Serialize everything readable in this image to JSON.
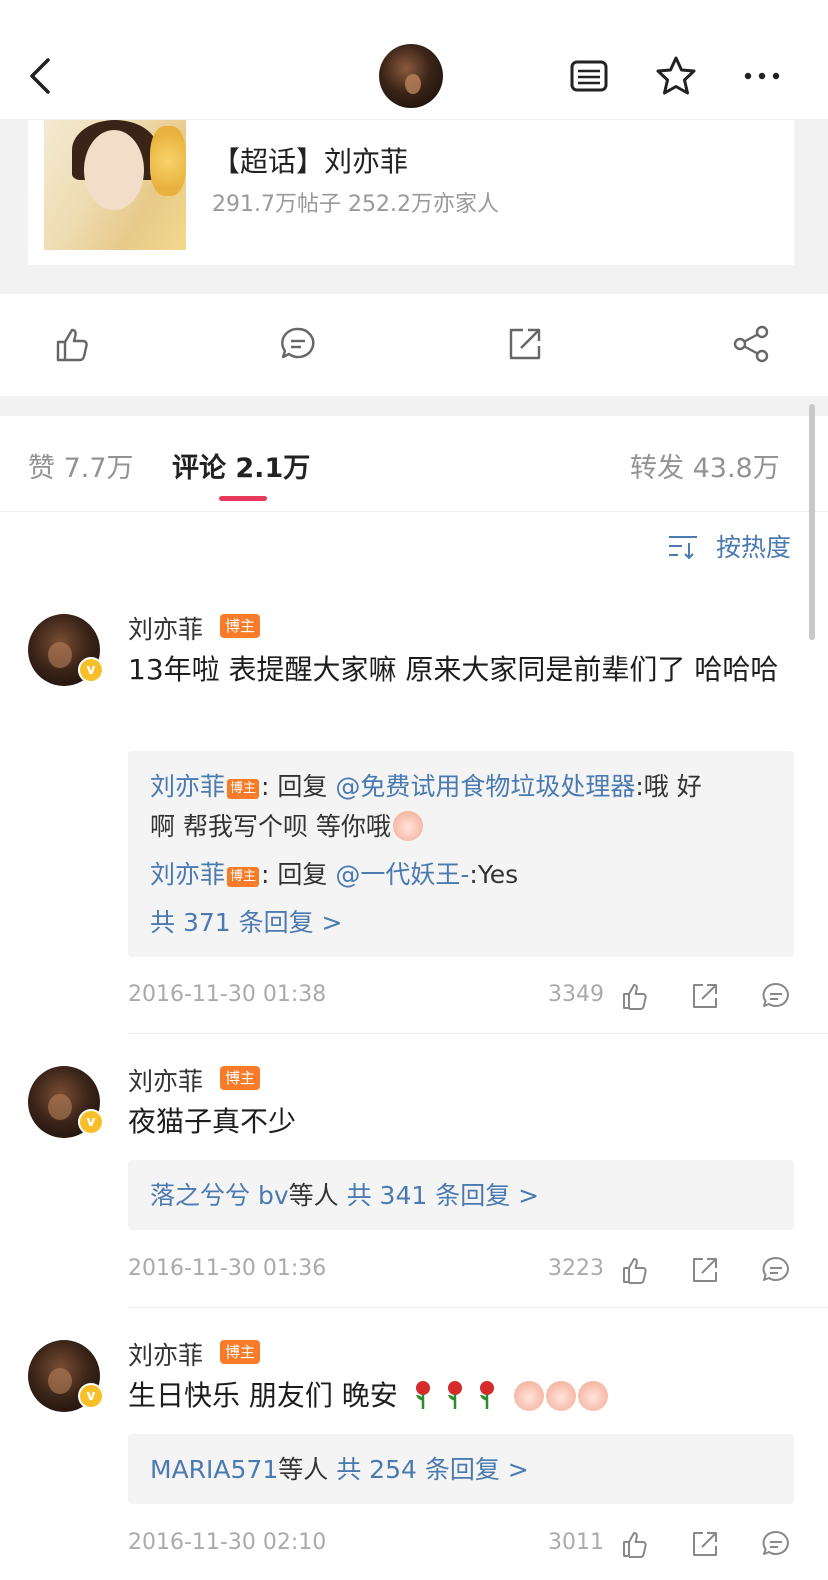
{
  "nav": {
    "back": "back",
    "menu_icon": "list-icon",
    "star_icon": "star-icon",
    "more_icon": "more-icon"
  },
  "topic": {
    "title": "【超话】刘亦菲",
    "stats": "291.7万帖子 252.2万亦家人"
  },
  "tabs": {
    "likes": "赞 7.7万",
    "comments": "评论 2.1万",
    "reposts": "转发 43.8万"
  },
  "sort": {
    "label": "按热度"
  },
  "comments": [
    {
      "name": "刘亦菲",
      "badge": "博主",
      "text": "13年啦 表提醒大家嘛 原来大家同是前辈们了 哈哈哈",
      "replies": [
        {
          "name": "刘亦菲",
          "badge": "博主",
          "prefix": ": 回复 ",
          "mention": "@免费试用食物垃圾处理器",
          "text_a": ":哦 好",
          "text_b": "啊 帮我写个呗 等你哦"
        },
        {
          "name": "刘亦菲",
          "badge": "博主",
          "prefix": ": 回复 ",
          "mention": "@一代妖王-",
          "text_a": ":Yes"
        }
      ],
      "more": "共 371 条回复 >",
      "time": "2016-11-30 01:38",
      "likes": "3349"
    },
    {
      "name": "刘亦菲",
      "badge": "博主",
      "text": "夜猫子真不少",
      "reply_user": "落之兮兮 bv",
      "reply_mid": "等人",
      "more": "共 341 条回复 >",
      "time": "2016-11-30 01:36",
      "likes": "3223"
    },
    {
      "name": "刘亦菲",
      "badge": "博主",
      "text": "生日快乐 朋友们 晚安",
      "reply_user": "MARIA571",
      "reply_mid": "等人",
      "more": "共 254 条回复 >",
      "time": "2016-11-30 02:10",
      "likes": "3011"
    }
  ]
}
